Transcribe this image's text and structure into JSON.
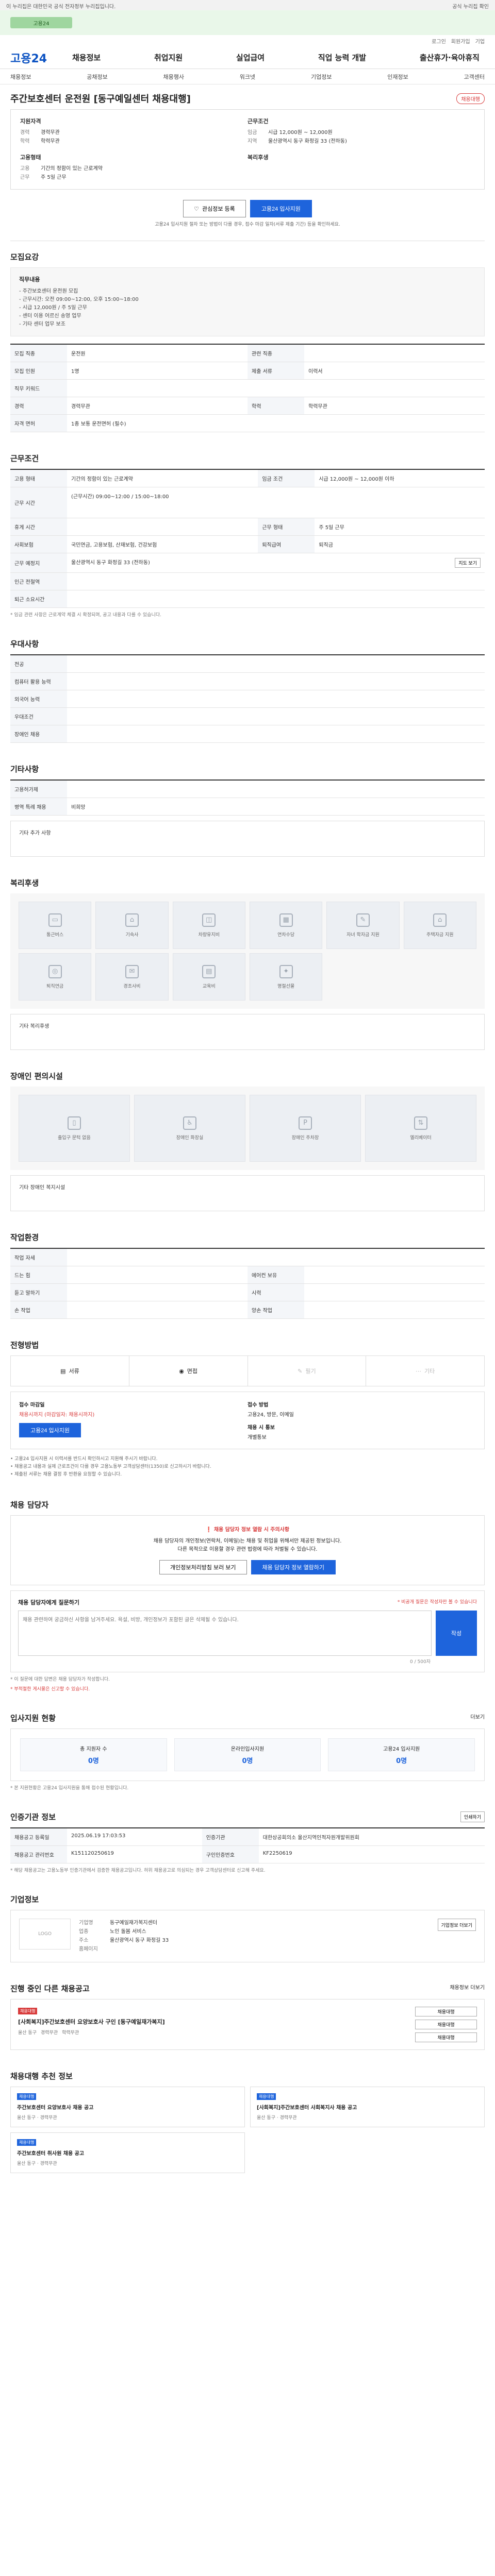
{
  "gov": {
    "text": "이 누리집은 대한민국 공식 전자정부 누리집입니다.",
    "link": "공식 누리집 확인"
  },
  "strip": {
    "pill": "고용24"
  },
  "util": [
    "로그인",
    "회원가입",
    "기업"
  ],
  "nav": {
    "logo": "고용24",
    "menu": [
      "채용정보",
      "취업지원",
      "실업급여",
      "직업 능력 개발",
      "출산휴가·육아휴직"
    ]
  },
  "subnav": [
    "채용정보",
    "공채정보",
    "채용행사",
    "워크넷",
    "기업정보",
    "인재정보",
    "고객센터"
  ],
  "job": {
    "title": "주간보호센터 운전원 [동구예일센터 채용대행]",
    "badge": "채용대행",
    "company_h": "지원자격",
    "company_rows": [
      {
        "k": "경력",
        "v": "경력무관"
      },
      {
        "k": "학력",
        "v": "학력무관"
      }
    ],
    "cond_h": "근무조건",
    "cond_rows": [
      {
        "k": "임금",
        "v": "시급 12,000원 ~ 12,000원"
      },
      {
        "k": "지역",
        "v": "울산광역시 동구 화정길 33 (전하동)"
      }
    ],
    "form_h": "고용형태",
    "form_rows": [
      {
        "k": "고용",
        "v": "기간의 정함이 있는 근로계약"
      },
      {
        "k": "근무",
        "v": "주 5일 근무"
      }
    ],
    "welfare_h": "복리후생",
    "welfare_rows": [
      {
        "k": "",
        "v": ""
      }
    ]
  },
  "apply": {
    "fav": "관심정보 등록",
    "apply": "고용24 입사지원",
    "note": "고용24 입사지원 절차 또는 방법이 다를 경우, 접수 마감 일자(서류 제출 기간) 등을 확인하세요."
  },
  "recruit": {
    "section": "모집요강",
    "box_title": "직무내용",
    "box_lines": [
      "- 주간보호센터 운전원 모집",
      "- 근무시간: 오전 09:00~12:00, 오후 15:00~18:00",
      "- 시급 12,000원 / 주 5일 근무",
      "- 센터 이용 어르신 송영 업무",
      "- 기타 센터 업무 보조"
    ],
    "rows": [
      {
        "k": "모집 직종",
        "v": "운전원",
        "k2": "관련 직종",
        "v2": ""
      },
      {
        "k": "모집 인원",
        "v": "1명",
        "k2": "제출 서류",
        "v2": "이력서"
      },
      {
        "k": "직무 키워드",
        "v": "",
        "k2": "",
        "v2": ""
      },
      {
        "k": "경력",
        "v": "경력무관",
        "k2": "학력",
        "v2": "학력무관"
      },
      {
        "k": "자격 면허",
        "v": "1종 보통 운전면허 (필수)",
        "k2": "",
        "v2": ""
      }
    ]
  },
  "work": {
    "section": "근무조건",
    "rows": [
      {
        "k": "고용 형태",
        "v": "기간의 정함이 있는 근로계약",
        "k2": "임금 조건",
        "v2": "시급 12,000원 ~ 12,000원 이하"
      },
      {
        "k": "근무 시간",
        "v": "(근무시간) 09:00~12:00 / 15:00~18:00",
        "k2": "",
        "v2": ""
      },
      {
        "k": "휴게 시간",
        "v": "",
        "k2": "근무 형태",
        "v2": "주 5일 근무"
      },
      {
        "k": "사회보험",
        "v": "국민연금, 고용보험, 산재보험, 건강보험",
        "k2": "퇴직급여",
        "v2": "퇴직금"
      },
      {
        "k": "근무 예정지",
        "v": "울산광역시 동구 화정길 33 (전하동)",
        "k2": "",
        "v2": ""
      },
      {
        "k": "인근 전철역",
        "v": "",
        "k2": "",
        "v2": ""
      },
      {
        "k": "퇴근 소요시간",
        "v": "",
        "k2": "",
        "v2": ""
      }
    ],
    "map_btn": "지도 보기",
    "note": "* 임금 관련 사항은 근로계약 체결 시 확정되며, 공고 내용과 다를 수 있습니다."
  },
  "prefer": {
    "section": "우대사항",
    "rows": [
      {
        "k": "전공",
        "v": ""
      },
      {
        "k": "컴퓨터 활용 능력",
        "v": ""
      },
      {
        "k": "외국어 능력",
        "v": ""
      },
      {
        "k": "우대조건",
        "v": ""
      },
      {
        "k": "장애인 채용",
        "v": ""
      }
    ]
  },
  "other": {
    "section": "기타사항",
    "rows": [
      {
        "k": "고용허가제",
        "v": ""
      },
      {
        "k": "병역 특례 채용",
        "v": "비희망"
      }
    ],
    "extra_title": "기타 추가 사항"
  },
  "benefits": {
    "section": "복리후생",
    "items": [
      "통근버스",
      "기숙사",
      "차량유지비",
      "연차수당",
      "자녀 학자금 지원",
      "주택자금 지원",
      "퇴직연금",
      "경조사비",
      "교육비",
      "명절선물"
    ],
    "extra_title": "기타 복리후생"
  },
  "disability": {
    "section": "장애인 편의시설",
    "items": [
      "출입구 문턱 없음",
      "장애인 화장실",
      "장애인 주차장",
      "엘리베이터"
    ],
    "extra_title": "기타 장애인 복지시설"
  },
  "env": {
    "section": "작업환경",
    "rows": [
      {
        "k": "작업 자세",
        "v": "",
        "k2": "",
        "v2": ""
      },
      {
        "k": "드는 힘",
        "v": "",
        "k2": "에어컨 보유",
        "v2": ""
      },
      {
        "k": "듣고 말하기",
        "v": "",
        "k2": "시력",
        "v2": ""
      },
      {
        "k": "손 작업",
        "v": "",
        "k2": "양손 작업",
        "v2": ""
      }
    ]
  },
  "method": {
    "section": "전형방법",
    "items": [
      "서류",
      "면접",
      "필기",
      "기타"
    ],
    "off": [
      false,
      false,
      true,
      true
    ],
    "deadline_h": "접수 마감일",
    "deadline_v": "채용시까지 (마감일자: 채용시까지)",
    "apply_h": "접수 방법",
    "apply_v": "고용24, 방문, 이메일",
    "apply_btn": "고용24 입사지원",
    "result_h": "채용 시 통보",
    "result_v": "개별통보",
    "bullets": [
      "• 고용24 입사지원 시 이력서를 반드시 확인하시고 지원해 주시기 바랍니다.",
      "• 채용공고 내용과 실제 근로조건이 다를 경우 고용노동부 고객상담센터(1350)로 신고하시기 바랍니다.",
      "• 제출된 서류는 채용 결정 후 반환을 요청할 수 있습니다."
    ]
  },
  "contact": {
    "section": "채용 담당자",
    "warn": "채용 담당자 정보 열람 시 주의사항",
    "line1": "채용 담당자의 개인정보(연락처, 이메일)는 채용 및 취업을 위해서만 제공된 정보입니다.",
    "line2": "다른 목적으로 이용할 경우 관련 법령에 따라 처벌될 수 있습니다.",
    "btn1": "개인정보처리방침 보러 보기",
    "btn2": "채용 담당자 정보 열람하기"
  },
  "inquiry": {
    "title": "채용 담당자에게 질문하기",
    "notice": "* 비공개 질문은 작성자만 볼 수 있습니다",
    "placeholder": "채용 관련하여 궁금하신 사항을 남겨주세요. 욕설, 비방, 개인정보가 포함된 글은 삭제될 수 있습니다.",
    "count": "0 / 500자",
    "btn": "작성",
    "foot1": "* 이 질문에 대한 답변은 채용 담당자가 작성합니다.",
    "foot2": "* 부적절한 게시물은 신고할 수 있습니다."
  },
  "status": {
    "section": "입사지원 현황",
    "more": "더보기",
    "items": [
      {
        "label": "총 지원자 수",
        "value": "0명"
      },
      {
        "label": "온라인입사지원",
        "value": "0명"
      },
      {
        "label": "고용24 입사지원",
        "value": "0명"
      }
    ],
    "note": "* 본 지원현황은 고용24 입사지원을 통해 접수된 현황입니다."
  },
  "info": {
    "section": "인증기관 정보",
    "print": "인쇄하기",
    "rows": [
      {
        "k": "채용공고 등록일",
        "v": "2025.06.19 17:03:53",
        "k2": "인증기관",
        "v2": "대한상공회의소 울산지역인적자원개발위원회"
      },
      {
        "k": "채용공고 관리번호",
        "v": "K151120250619",
        "k2": "구인인증번호",
        "v2": "KF2250619"
      }
    ],
    "note": "* 해당 채용공고는 고용노동부 인증기관에서 검증한 채용공고입니다. 허위 채용공고로 의심되는 경우 고객상담센터로 신고해 주세요."
  },
  "company": {
    "section": "기업정보",
    "logo": "LOGO",
    "rows": [
      {
        "k": "기업명",
        "v": "동구예일재가복지센터"
      },
      {
        "k": "업종",
        "v": "노인 돌봄 서비스"
      },
      {
        "k": "주소",
        "v": "울산광역시 동구 화정길 33"
      },
      {
        "k": "홈페이지",
        "v": ""
      }
    ],
    "btn": "기업정보 더보기"
  },
  "others": {
    "section": "진행 중인 다른 채용공고",
    "more": "채용정보 더보기",
    "card_tag": "채용대행",
    "card_title": "[사회복지]주간보호센터 요양보호사 구인 [동구예일재가복지]",
    "card_meta": [
      "울산 동구",
      "경력무관",
      "학력무관"
    ],
    "side": [
      "채용대행",
      "채용대행",
      "채용대행"
    ]
  },
  "recommend": {
    "section": "채용대행 추천 정보",
    "cards": [
      {
        "tag": "채용대행",
        "title": "주간보호센터 요양보호사 채용 공고",
        "meta": "울산 동구 · 경력무관"
      },
      {
        "tag": "채용대행",
        "title": "[사회복지]주간보호센터 사회복지사 채용 공고",
        "meta": "울산 동구 · 경력무관"
      },
      {
        "tag": "채용대행",
        "title": "주간보호센터 취사원 채용 공고",
        "meta": "울산 동구 · 경력무관"
      }
    ]
  }
}
